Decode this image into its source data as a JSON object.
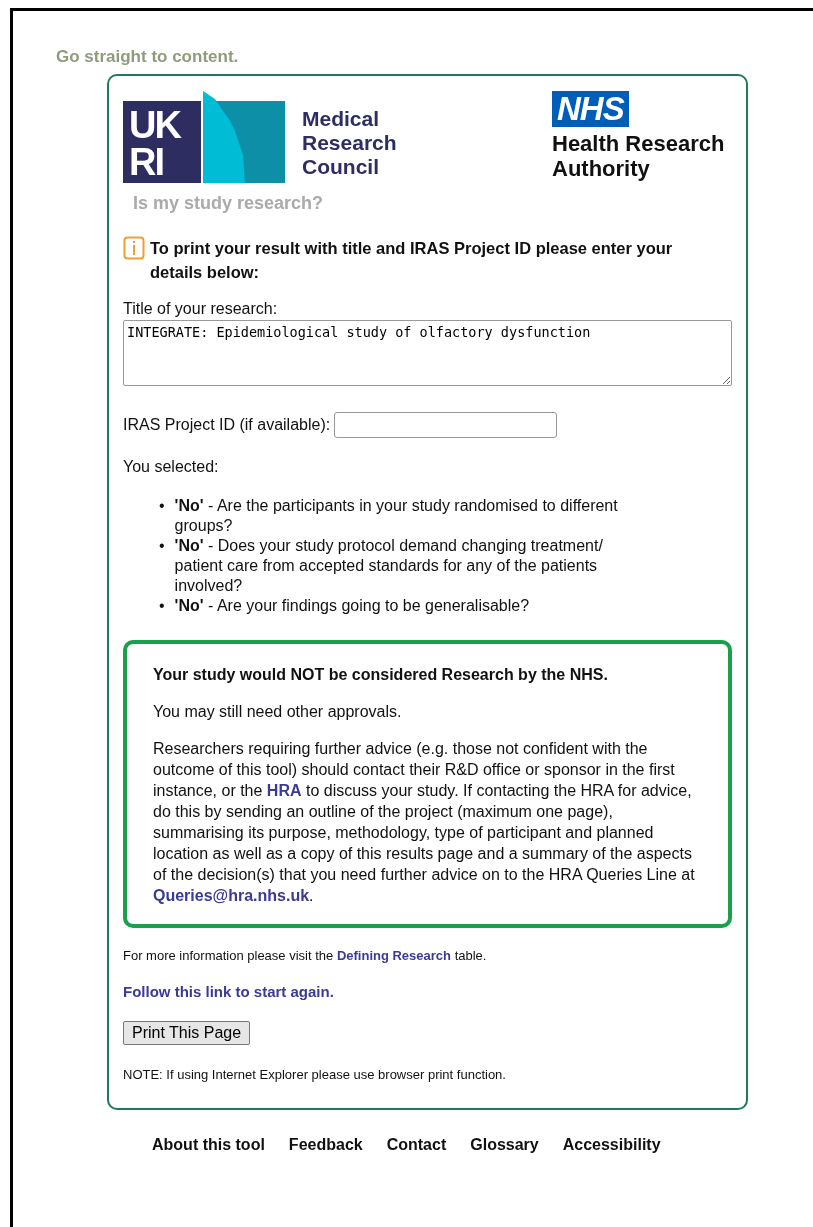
{
  "skip_link": "Go straight to content.",
  "logos": {
    "ukri_top": "UK",
    "ukri_bottom": "RI",
    "council_lines": [
      "Medical",
      "Research",
      "Council"
    ],
    "nhs_badge": "NHS",
    "authority_lines": [
      "Health Research",
      "Authority"
    ]
  },
  "page_title": "Is my study research?",
  "notice": "To print your result with title and IRAS Project ID please enter your details below:",
  "title_field": {
    "label": "Title of your research:",
    "value": "INTEGRATE: Epidemiological study of olfactory dysfunction"
  },
  "iras_field": {
    "label": "IRAS Project ID (if available):"
  },
  "selected_heading": "You selected:",
  "selections": [
    {
      "marker": "•",
      "text": "**'No'** - Are the participants in your study randomised to different groups?"
    },
    {
      "marker": "•",
      "text": "**'No'** - Does your study protocol demand changing treatment/ patient care from accepted standards for any of the patients involved?"
    },
    {
      "marker": "•",
      "text": "**'No'** - Are your findings going to be generalisable?"
    }
  ],
  "result": {
    "heading": "Your study would NOT be considered Research by the NHS.",
    "paragraphs": [
      [
        {
          "kind": "text",
          "text": "You may still need other approvals."
        }
      ],
      [
        {
          "kind": "text",
          "text": "Researchers requiring further advice (e.g. those not confident with the outcome of this tool) should contact their R&D office or sponsor in the first instance, or the "
        },
        {
          "kind": "link",
          "text": "HRA"
        },
        {
          "kind": "text",
          "text": " to discuss your study. If contacting the HRA for advice, do this by sending an outline of the project (maximum one page), summarising its purpose, methodology, type of participant and planned location as well as a copy of this results page and a summary of the aspects of the decision(s) that you need further advice on to the HRA Queries Line at "
        },
        {
          "kind": "link",
          "text": "Queries@hra.nhs.uk"
        },
        {
          "kind": "text",
          "text": "."
        }
      ]
    ]
  },
  "more_info": [
    {
      "kind": "text",
      "text": "For more information please visit the "
    },
    {
      "kind": "link",
      "text": "Defining Research"
    },
    {
      "kind": "text",
      "text": " table."
    }
  ],
  "restart_link": "Follow this link to start again.",
  "print_button": "Print This Page",
  "note": "NOTE: If using Internet Explorer please use browser print function.",
  "footer_links": [
    "About this tool",
    "Feedback",
    "Contact",
    "Glossary",
    "Accessibility"
  ]
}
